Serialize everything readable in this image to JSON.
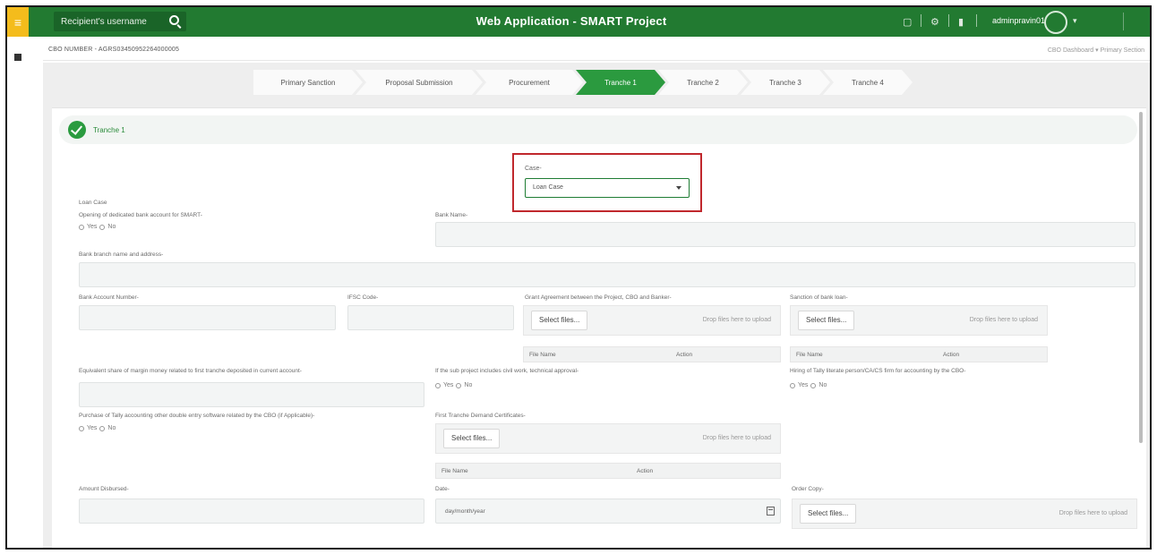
{
  "header": {
    "title": "Web Application - SMART Project",
    "search_placeholder": "Recipient's username",
    "user": "adminpravin01",
    "icons": [
      "menu-icon",
      "search-icon",
      "apps-icon",
      "settings-icon",
      "notification-icon",
      "user-avatar",
      "chevron-down-icon"
    ]
  },
  "subheader": {
    "cbo_number": "CBO NUMBER - AGRS03450952264000005",
    "breadcrumb": "CBO Dashboard  ▾  Primary Section"
  },
  "steps": [
    {
      "label": "Primary Sanction",
      "active": false
    },
    {
      "label": "Proposal Submission",
      "active": false
    },
    {
      "label": "Procurement",
      "active": false
    },
    {
      "label": "Tranche 1",
      "active": true
    },
    {
      "label": "Tranche 2",
      "active": false
    },
    {
      "label": "Tranche 3",
      "active": false
    },
    {
      "label": "Tranche 4",
      "active": false
    }
  ],
  "section": {
    "title": "Tranche 1"
  },
  "case": {
    "label": "Case-",
    "value": "Loan Case"
  },
  "form": {
    "case_heading": "Loan Case",
    "dedicated_account_label": "Opening of dedicated bank account for SMART-",
    "bank_name_label": "Bank Name-",
    "bank_branch_label": "Bank branch name and address-",
    "account_number_label": "Bank Account Number-",
    "ifsc_label": "IFSC Code-",
    "grant_agreement_label": "Grant Agreement between the Project, CBO and Banker-",
    "sanction_label": "Sanction of bank loan-",
    "equivalent_share_label": "Equivalent share of margin money related to first tranche deposited in current account-",
    "civil_work_label": "If the sub project includes civil work, technical approval-",
    "tally_person_label": "Hiring of Tally literate person/CA/CS firm for accounting by the CBO-",
    "tally_purchase_label": "Purchase of Tally accounting other double entry software related by the CBO (if Applicable)-",
    "demand_cert_label": "First Tranche Demand Certificates-",
    "amount_disbursed_label": "Amount Disbursed-",
    "date_label": "Date-",
    "date_placeholder": "day/month/year",
    "order_copy_label": "Order Copy-",
    "yes": "Yes",
    "no": "No",
    "select_files": "Select files...",
    "drop_files": "Drop files here to upload",
    "file_name": "File Name",
    "action": "Action"
  }
}
